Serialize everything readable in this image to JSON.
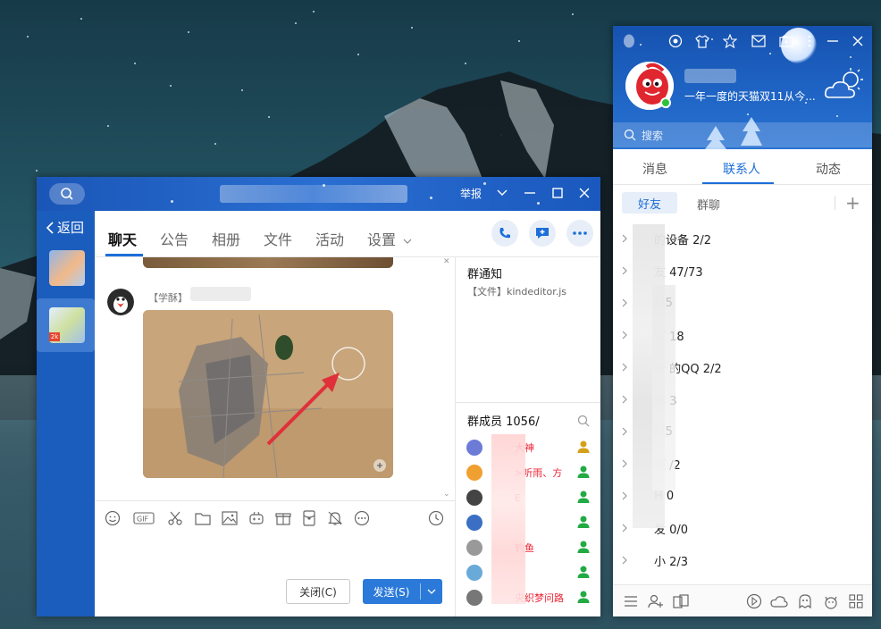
{
  "chat_window": {
    "titlebar": {
      "report_label": "举报",
      "controls": [
        "chevron-down-icon",
        "minimize-icon",
        "maximize-icon",
        "close-icon"
      ]
    },
    "sidebar": {
      "back_label": "返回"
    },
    "tabs": [
      {
        "label": "聊天",
        "active": true
      },
      {
        "label": "公告"
      },
      {
        "label": "相册"
      },
      {
        "label": "文件"
      },
      {
        "label": "活动"
      },
      {
        "label": "设置"
      }
    ],
    "message": {
      "sender_tag": "【学酥】"
    },
    "group_panel": {
      "notice_title": "群通知",
      "notice_file": "【文件】kindeditor.js",
      "members_title": "群成员 1056/",
      "members": [
        {
          "name": "大神",
          "color": "#d4a017"
        },
        {
          "name": ">听雨、方",
          "color": "#22aa44"
        },
        {
          "name": "E",
          "color": "#22aa44"
        },
        {
          "name": "",
          "color": "#22aa44"
        },
        {
          "name": "钓鱼",
          "color": "#22aa44"
        },
        {
          "name": "",
          "color": "#22aa44"
        },
        {
          "name": "央织梦问路",
          "color": "#22aa44"
        }
      ]
    },
    "toolbar_icons": [
      "emoji-icon",
      "gif-icon",
      "scissors-icon",
      "folder-icon",
      "image-icon",
      "gamepad-icon",
      "gift-icon",
      "red-packet-icon",
      "bell-icon",
      "more-icon",
      "clock-icon"
    ],
    "close_button": "关闭(C)",
    "send_button": "发送(S)"
  },
  "qq_panel": {
    "signature": "一年一度的天猫双11从今...",
    "search_placeholder": "搜索",
    "tabs": [
      {
        "label": "消息"
      },
      {
        "label": "联系人",
        "active": true
      },
      {
        "label": "动态"
      }
    ],
    "segment_friends": "好友",
    "segment_groups": "群聊",
    "groups": [
      {
        "name": "的设备 2/2"
      },
      {
        "name": "友 47/73"
      },
      {
        "name": "/25"
      },
      {
        "name": "第 18"
      },
      {
        "name": "新 的QQ 2/2"
      },
      {
        "name": "事 3"
      },
      {
        "name": "/25"
      },
      {
        "name": "题 /2"
      },
      {
        "name": "H 0"
      },
      {
        "name": "发 0/0"
      },
      {
        "name": "小 2/3"
      }
    ],
    "accent_color": "#1c6ed8"
  }
}
